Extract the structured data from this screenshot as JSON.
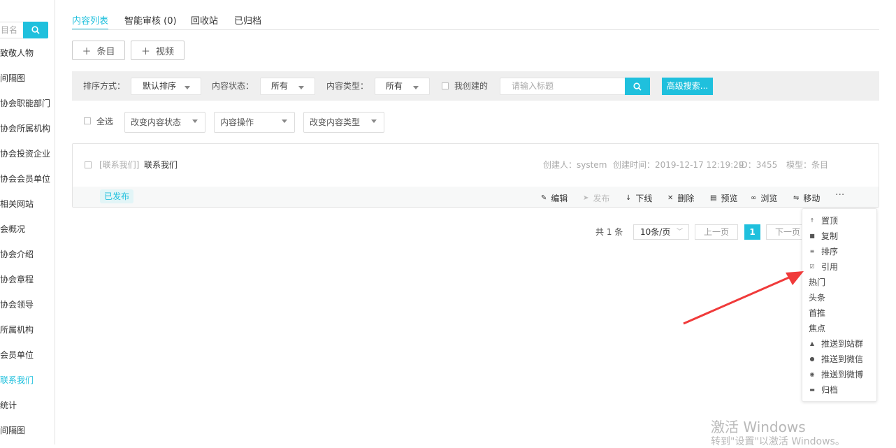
{
  "sidebar": {
    "search_placeholder": "目名",
    "items": [
      {
        "label": "致敬人物"
      },
      {
        "label": "间隔图"
      },
      {
        "label": "协会职能部门"
      },
      {
        "label": "协会所属机构"
      },
      {
        "label": "协会投资企业"
      },
      {
        "label": "协会会员单位"
      },
      {
        "label": "相关网站"
      },
      {
        "label": "会概况"
      },
      {
        "label": "协会介绍"
      },
      {
        "label": "协会章程"
      },
      {
        "label": "协会领导"
      },
      {
        "label": "所属机构"
      },
      {
        "label": "会员单位"
      },
      {
        "label": "联系我们",
        "active": true
      },
      {
        "label": "统计"
      },
      {
        "label": "间隔图"
      }
    ]
  },
  "tabs": [
    {
      "label": "内容列表"
    },
    {
      "label": "智能审核 (0)"
    },
    {
      "label": "回收站"
    },
    {
      "label": "已归档"
    }
  ],
  "toolbar": {
    "add_item": "条目",
    "add_video": "视频",
    "plus": "＋"
  },
  "filters": {
    "sort_label": "排序方式：",
    "sort_value": "默认排序",
    "status_label": "内容状态：",
    "status_value": "所有",
    "type_label": "内容类型：",
    "type_value": "所有",
    "mine_label": "我创建的",
    "search_placeholder": "请输入标题",
    "advanced": "高级搜索..."
  },
  "bulk": {
    "select_all": "全选",
    "change_status": "改变内容状态",
    "content_ops": "内容操作",
    "change_type": "改变内容类型"
  },
  "item": {
    "category": "[联系我们]",
    "title": "联系我们",
    "creator": "创建人：system",
    "created": "创建时间：2019-12-17 12:19:29",
    "id": "ID：3455",
    "model": "模型：条目",
    "status": "已发布",
    "actions": [
      {
        "label": "编辑",
        "icon": "✎"
      },
      {
        "label": "发布",
        "icon": "➤",
        "disabled": true
      },
      {
        "label": "下线",
        "icon": "↓"
      },
      {
        "label": "删除",
        "icon": "✕"
      },
      {
        "label": "预览",
        "icon": "▤"
      },
      {
        "label": "浏览",
        "icon": "∞"
      },
      {
        "label": "移动",
        "icon": "⇋"
      }
    ],
    "more": "···"
  },
  "pagination": {
    "total": "共 1 条",
    "page_size": "10条/页",
    "prev": "上一页",
    "current": "1",
    "next": "下一页"
  },
  "more_menu": [
    {
      "label": "置顶",
      "icon": "↑"
    },
    {
      "label": "复制",
      "icon": "■"
    },
    {
      "label": "排序",
      "icon": "≡"
    },
    {
      "label": "引用",
      "icon": "☑"
    },
    {
      "label": "热门"
    },
    {
      "label": "头条"
    },
    {
      "label": "首推"
    },
    {
      "label": "焦点"
    },
    {
      "label": "推送到站群",
      "icon": "▲"
    },
    {
      "label": "推送到微信",
      "icon": "●"
    },
    {
      "label": "推送到微博",
      "icon": "◉"
    },
    {
      "label": "归档",
      "icon": "▬"
    }
  ],
  "watermark": {
    "line1": "激活 Windows",
    "line2": "转到\"设置\"以激活 Windows。"
  },
  "colors": {
    "accent": "#1fc0dd",
    "arrow": "#f03a3a"
  }
}
